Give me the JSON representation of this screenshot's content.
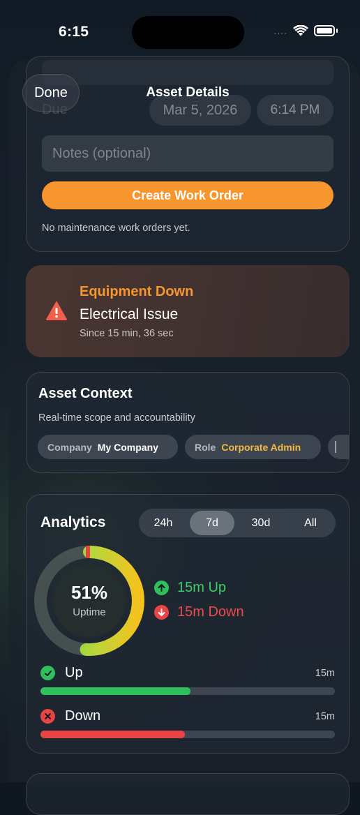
{
  "status_bar": {
    "time": "6:15",
    "signal": "....",
    "wifi_icon": "wifi-icon",
    "battery_icon": "battery-icon"
  },
  "nav": {
    "done_label": "Done",
    "title": "Asset Details"
  },
  "work_order_form": {
    "due_label": "Due",
    "due_date": "Mar 5, 2026",
    "due_time": "6:14 PM",
    "notes_placeholder": "Notes (optional)",
    "create_button": "Create Work Order",
    "empty_message": "No maintenance work orders yet."
  },
  "alert": {
    "icon": "warning-triangle-icon",
    "title": "Equipment Down",
    "subtitle": "Electrical Issue",
    "since": "Since 15 min, 36 sec",
    "accent_color": "#f7962f"
  },
  "asset_context": {
    "title": "Asset Context",
    "subtitle": "Real-time scope and accountability",
    "chips": [
      {
        "key": "Company",
        "value": "My Company"
      },
      {
        "key": "Role",
        "value": "Corporate Admin"
      }
    ]
  },
  "analytics": {
    "title": "Analytics",
    "ranges": [
      "24h",
      "7d",
      "30d",
      "All"
    ],
    "selected_range": "7d",
    "uptime_percent": "51%",
    "uptime_label": "Uptime",
    "uptime_fraction": 0.51,
    "legend_up": "15m Up",
    "legend_down": "15m Down",
    "rows": [
      {
        "label": "Up",
        "value": "15m",
        "fraction": 0.51,
        "color": "#2ec05c",
        "icon": "check-circle-icon"
      },
      {
        "label": "Down",
        "value": "15m",
        "fraction": 0.49,
        "color": "#e84444",
        "icon": "x-circle-icon"
      }
    ]
  }
}
